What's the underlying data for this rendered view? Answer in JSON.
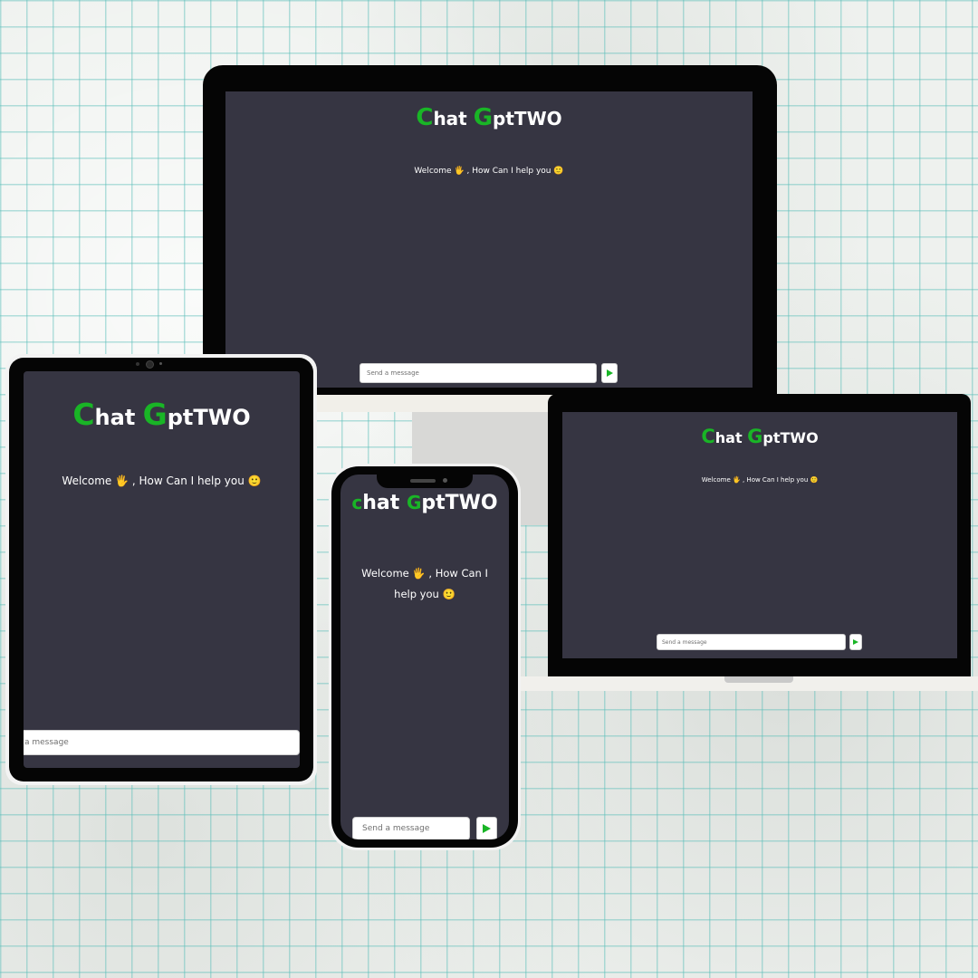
{
  "app": {
    "brand_c": "C",
    "brand_hat": "hat ",
    "brand_g": "G",
    "brand_rest": "ptTWO",
    "phone_brand_c": "c",
    "phone_brand_hat": "hat ",
    "phone_brand_g": "G",
    "phone_brand_rest": "ptTWO",
    "welcome_pre": "Welcome ",
    "welcome_post": " , How Can I help you ",
    "phone_welcome_line1": " , How Can I",
    "phone_welcome_line2": "help you ",
    "wave_emoji": "🖐",
    "smile_emoji": "🙂",
    "input_placeholder": "Send a message",
    "tablet_input_placeholder": "a message"
  },
  "icons": {
    "send": "send-triangle-icon"
  },
  "colors": {
    "accent": "#19b526",
    "screen_bg": "#363542",
    "bezel": "#050505"
  }
}
